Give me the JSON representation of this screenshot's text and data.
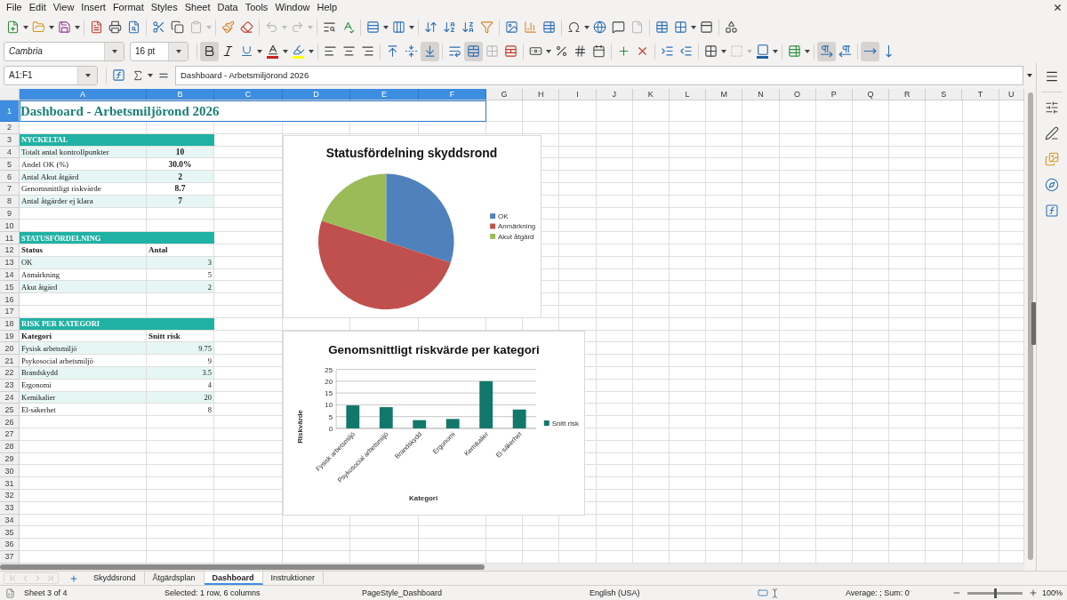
{
  "menu": [
    "File",
    "Edit",
    "View",
    "Insert",
    "Format",
    "Styles",
    "Sheet",
    "Data",
    "Tools",
    "Window",
    "Help"
  ],
  "standard_toolbar": {
    "paste_enabled": false,
    "undo_enabled": false,
    "redo_enabled": false,
    "headers_footers_enabled": false
  },
  "format_toolbar": {
    "font_name": "Cambria",
    "font_size": "16 pt",
    "toggles": {
      "bold": true,
      "italic": false,
      "underline": false,
      "align_left": false,
      "align_center": false,
      "align_right": false,
      "align_top": false,
      "align_middle": false,
      "align_bottom": true,
      "wrap_text": false,
      "merge_center": true,
      "left_to_right": true,
      "right_to_left": false,
      "text_horizontal": true,
      "text_vertical": false
    },
    "merge_cells_enabled": false,
    "border_style_enabled": false
  },
  "formula_bar": {
    "name_box": "A1:F1",
    "formula": "Dashboard - Arbetsmiljörond 2026"
  },
  "columns": [
    {
      "label": "A",
      "selected": true
    },
    {
      "label": "B",
      "selected": true
    },
    {
      "label": "C",
      "selected": true
    },
    {
      "label": "D",
      "selected": true
    },
    {
      "label": "E",
      "selected": true
    },
    {
      "label": "F",
      "selected": true
    },
    {
      "label": "G",
      "selected": false
    },
    {
      "label": "H",
      "selected": false
    },
    {
      "label": "I",
      "selected": false
    },
    {
      "label": "J",
      "selected": false
    },
    {
      "label": "K",
      "selected": false
    },
    {
      "label": "L",
      "selected": false
    },
    {
      "label": "M",
      "selected": false
    },
    {
      "label": "N",
      "selected": false
    },
    {
      "label": "O",
      "selected": false
    },
    {
      "label": "P",
      "selected": false
    },
    {
      "label": "Q",
      "selected": false
    },
    {
      "label": "R",
      "selected": false
    },
    {
      "label": "S",
      "selected": false
    },
    {
      "label": "T",
      "selected": false
    },
    {
      "label": "U",
      "selected": false
    }
  ],
  "rows": [
    {
      "number": "1",
      "selected": true,
      "kind": "title",
      "text": "Dashboard - Arbetsmiljörond 2026"
    },
    {
      "number": "2",
      "selected": false,
      "kind": "empty"
    },
    {
      "number": "3",
      "selected": false,
      "kind": "section",
      "text": "NYCKELTAL"
    },
    {
      "number": "4",
      "selected": false,
      "kind": "metric",
      "shaded": true,
      "label": "Totalt antal kontrollpunkter",
      "value": "10"
    },
    {
      "number": "5",
      "selected": false,
      "kind": "metric",
      "shaded": false,
      "label": "Andel OK (%)",
      "value": "30.0%"
    },
    {
      "number": "6",
      "selected": false,
      "kind": "metric",
      "shaded": true,
      "label": "Antal Akut åtgärd",
      "value": "2"
    },
    {
      "number": "7",
      "selected": false,
      "kind": "metric",
      "shaded": false,
      "label": "Genomsnittligt riskvärde",
      "value": "8.7"
    },
    {
      "number": "8",
      "selected": false,
      "kind": "metric",
      "shaded": true,
      "label": "Antal åtgärder ej klara",
      "value": "7"
    },
    {
      "number": "9",
      "selected": false,
      "kind": "empty"
    },
    {
      "number": "10",
      "selected": false,
      "kind": "empty"
    },
    {
      "number": "11",
      "selected": false,
      "kind": "section",
      "text": "STATUSFÖRDELNING"
    },
    {
      "number": "12",
      "selected": false,
      "kind": "header",
      "label": "Status",
      "value": "Antal"
    },
    {
      "number": "13",
      "selected": false,
      "kind": "data",
      "shaded": true,
      "label": "OK",
      "value": "3"
    },
    {
      "number": "14",
      "selected": false,
      "kind": "data",
      "shaded": false,
      "label": "Anmärkning",
      "value": "5"
    },
    {
      "number": "15",
      "selected": false,
      "kind": "data",
      "shaded": true,
      "label": "Akut åtgärd",
      "value": "2"
    },
    {
      "number": "16",
      "selected": false,
      "kind": "empty"
    },
    {
      "number": "17",
      "selected": false,
      "kind": "empty"
    },
    {
      "number": "18",
      "selected": false,
      "kind": "section",
      "text": "RISK PER KATEGORI"
    },
    {
      "number": "19",
      "selected": false,
      "kind": "header",
      "label": "Kategori",
      "value": "Snitt risk"
    },
    {
      "number": "20",
      "selected": false,
      "kind": "data",
      "shaded": true,
      "label": "Fysisk arbetsmiljö",
      "value": "9.75"
    },
    {
      "number": "21",
      "selected": false,
      "kind": "data",
      "shaded": false,
      "label": "Psykosocial arbetsmiljö",
      "value": "9"
    },
    {
      "number": "22",
      "selected": false,
      "kind": "data",
      "shaded": true,
      "label": "Brandskydd",
      "value": "3.5"
    },
    {
      "number": "23",
      "selected": false,
      "kind": "data",
      "shaded": false,
      "label": "Ergonomi",
      "value": "4"
    },
    {
      "number": "24",
      "selected": false,
      "kind": "data",
      "shaded": true,
      "label": "Kemikalier",
      "value": "20"
    },
    {
      "number": "25",
      "selected": false,
      "kind": "data",
      "shaded": false,
      "label": "El-säkerhet",
      "value": "8"
    },
    {
      "number": "26",
      "selected": false,
      "kind": "empty"
    },
    {
      "number": "27",
      "selected": false,
      "kind": "empty"
    },
    {
      "number": "28",
      "selected": false,
      "kind": "empty"
    },
    {
      "number": "29",
      "selected": false,
      "kind": "empty"
    },
    {
      "number": "30",
      "selected": false,
      "kind": "empty"
    },
    {
      "number": "31",
      "selected": false,
      "kind": "empty"
    },
    {
      "number": "32",
      "selected": false,
      "kind": "empty"
    },
    {
      "number": "33",
      "selected": false,
      "kind": "empty"
    },
    {
      "number": "34",
      "selected": false,
      "kind": "empty"
    },
    {
      "number": "35",
      "selected": false,
      "kind": "empty"
    },
    {
      "number": "36",
      "selected": false,
      "kind": "empty"
    },
    {
      "number": "37",
      "selected": false,
      "kind": "empty"
    }
  ],
  "status_chart": {
    "chart_data": {
      "type": "pie",
      "title": "Statusfördelning skyddsrond",
      "categories": [
        "OK",
        "Anmärkning",
        "Akut åtgärd"
      ],
      "values": [
        30,
        50,
        20
      ],
      "legend": "right"
    },
    "slices": [
      {
        "color": "#4f81bd"
      },
      {
        "color": "#c0504d"
      },
      {
        "color": "#9bbb59"
      }
    ]
  },
  "risk_chart": {
    "chart_data": {
      "type": "bar",
      "title": "Genomsnittligt riskvärde per kategori",
      "xlabel": "Kategori",
      "ylabel": "Riskvärde",
      "categories": [
        "Fysisk arbetsmiljö",
        "Psykosocial arbetsmiljö",
        "Brandskydd",
        "Ergonomi",
        "Kemikalier",
        "El-säkerhet"
      ],
      "series": [
        {
          "name": "Snitt risk",
          "color": "#12786b",
          "values": [
            9.75,
            9,
            3.5,
            4,
            20,
            8
          ]
        }
      ],
      "ylim": [
        0,
        25
      ],
      "yticks": [
        0,
        5,
        10,
        15,
        20,
        25
      ],
      "grid": true,
      "legend": "right"
    }
  },
  "sheet_tabs": {
    "nav_enabled": false,
    "tabs": [
      {
        "label": "Skyddsrond",
        "selected": false
      },
      {
        "label": "Åtgärdsplan",
        "selected": false
      },
      {
        "label": "Dashboard",
        "selected": true
      },
      {
        "label": "Instruktioner",
        "selected": false
      }
    ]
  },
  "status_bar": {
    "sheet": "Sheet 3 of 4",
    "selection": "Selected: 1 row, 6 columns",
    "page_style": "PageStyle_Dashboard",
    "language": "English (USA)",
    "summary": "Average: ; Sum: 0",
    "zoom": {
      "level": 0.5,
      "reading": "100%"
    }
  }
}
